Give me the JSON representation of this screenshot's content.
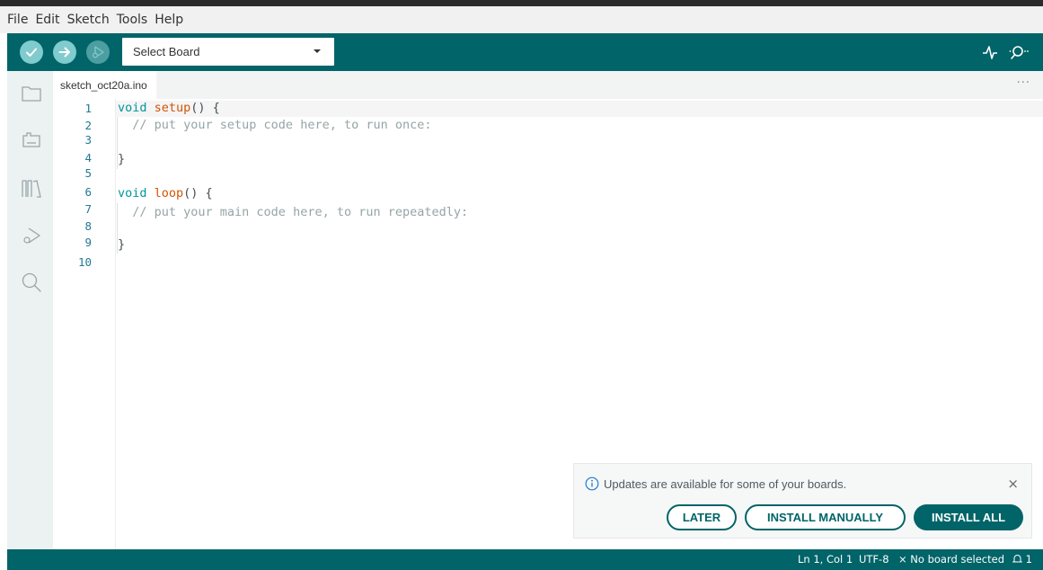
{
  "menubar": {
    "items": [
      "File",
      "Edit",
      "Sketch",
      "Tools",
      "Help"
    ]
  },
  "toolbar": {
    "board_select_label": "Select Board",
    "icons": [
      "verify-icon",
      "upload-icon",
      "debug-icon",
      "serial-plotter-icon",
      "serial-monitor-icon"
    ]
  },
  "sidebar": {
    "icons": [
      "sketchbook-icon",
      "boards-manager-icon",
      "library-manager-icon",
      "debug-icon",
      "search-icon"
    ]
  },
  "tabs": {
    "active_label": "sketch_oct20a.ino",
    "more_label": "···"
  },
  "editor": {
    "line_numbers": [
      "1",
      "2",
      "3",
      "4",
      "5",
      "6",
      "7",
      "8",
      "9",
      "10"
    ],
    "lines": {
      "l1_kw": "void",
      "l1_fn": "setup",
      "l1_rest": "() {",
      "l2": "  // put your setup code here, to run once:",
      "l4": "}",
      "l6_kw": "void",
      "l6_fn": "loop",
      "l6_rest": "() {",
      "l7": "  // put your main code here, to run repeatedly:",
      "l9": "}"
    }
  },
  "notification": {
    "message": "Updates are available for some of your boards.",
    "close": "×",
    "buttons": {
      "later": "LATER",
      "manual": "INSTALL MANUALLY",
      "all": "INSTALL ALL"
    }
  },
  "statusbar": {
    "position": "Ln 1, Col 1",
    "encoding": "UTF-8",
    "board_status": "× No board selected",
    "notification_count": "1"
  },
  "colors": {
    "accent": "#006468",
    "toolbar_button": "#7fcbcd",
    "keyword": "#00979c",
    "function": "#d35400",
    "comment": "#95a5a6"
  }
}
